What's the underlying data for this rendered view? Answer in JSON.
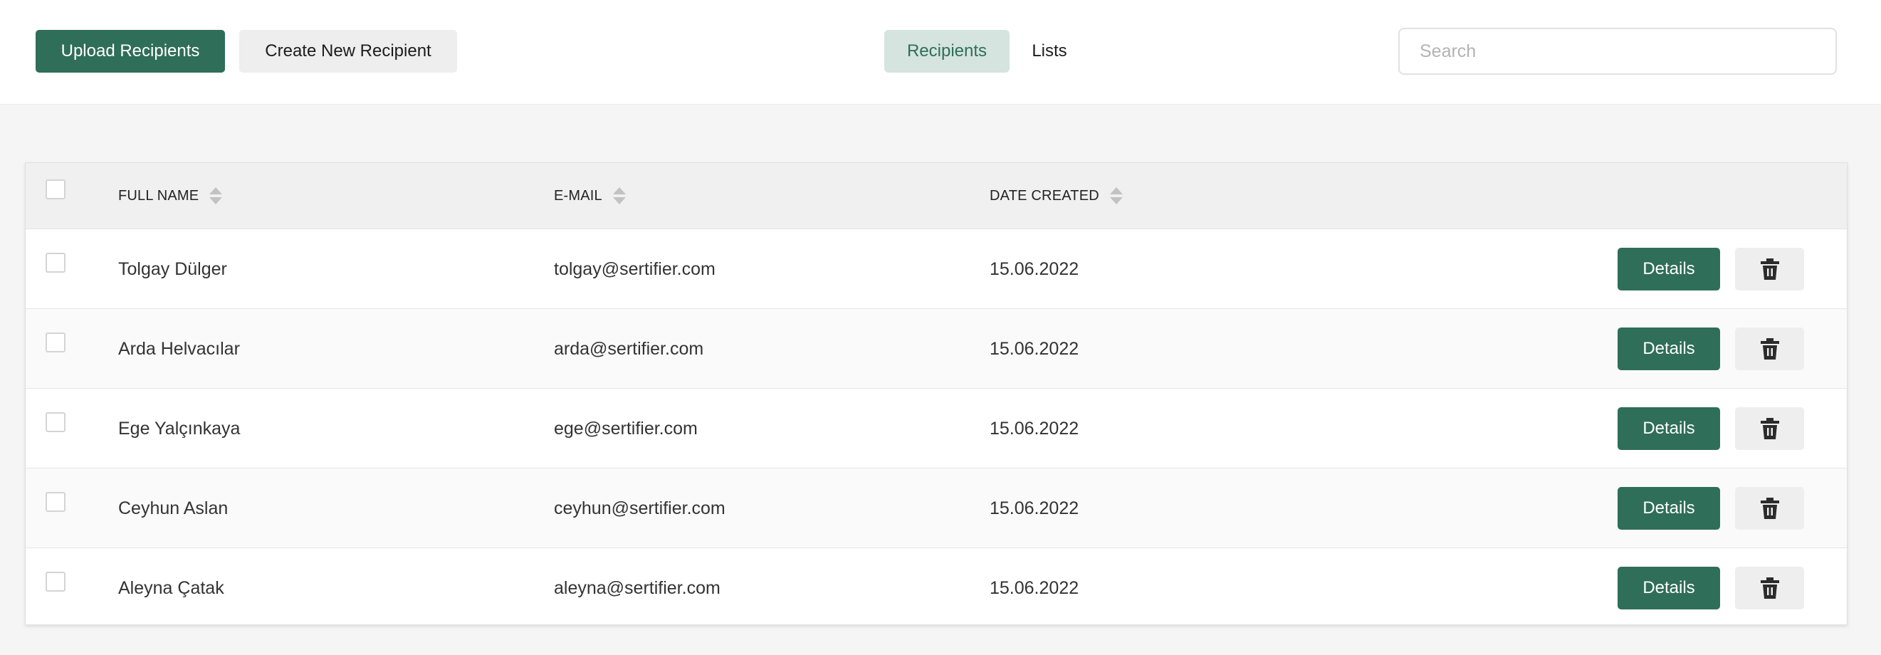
{
  "toolbar": {
    "upload_label": "Upload Recipients",
    "create_label": "Create New Recipient"
  },
  "tabs": {
    "recipients_label": "Recipients",
    "lists_label": "Lists",
    "active": "Recipients"
  },
  "search": {
    "placeholder": "Search",
    "value": ""
  },
  "table": {
    "headers": {
      "full_name": "FULL NAME",
      "email": "E-MAIL",
      "date_created": "DATE CREATED"
    },
    "rows": [
      {
        "name": "Tolgay Dülger",
        "email": "tolgay@sertifier.com",
        "date": "15.06.2022",
        "details_label": "Details"
      },
      {
        "name": "Arda Helvacılar",
        "email": "arda@sertifier.com",
        "date": "15.06.2022",
        "details_label": "Details"
      },
      {
        "name": "Ege Yalçınkaya",
        "email": "ege@sertifier.com",
        "date": "15.06.2022",
        "details_label": "Details"
      },
      {
        "name": "Ceyhun Aslan",
        "email": "ceyhun@sertifier.com",
        "date": "15.06.2022",
        "details_label": "Details"
      },
      {
        "name": "Aleyna Çatak",
        "email": "aleyna@sertifier.com",
        "date": "15.06.2022",
        "details_label": "Details"
      }
    ]
  },
  "icons": {
    "sort": "sort-icon",
    "delete": "trash-icon"
  },
  "colors": {
    "primary": "#2f6e59",
    "active_tab_bg": "#d5e4de",
    "secondary_button_bg": "#eeeeee"
  }
}
